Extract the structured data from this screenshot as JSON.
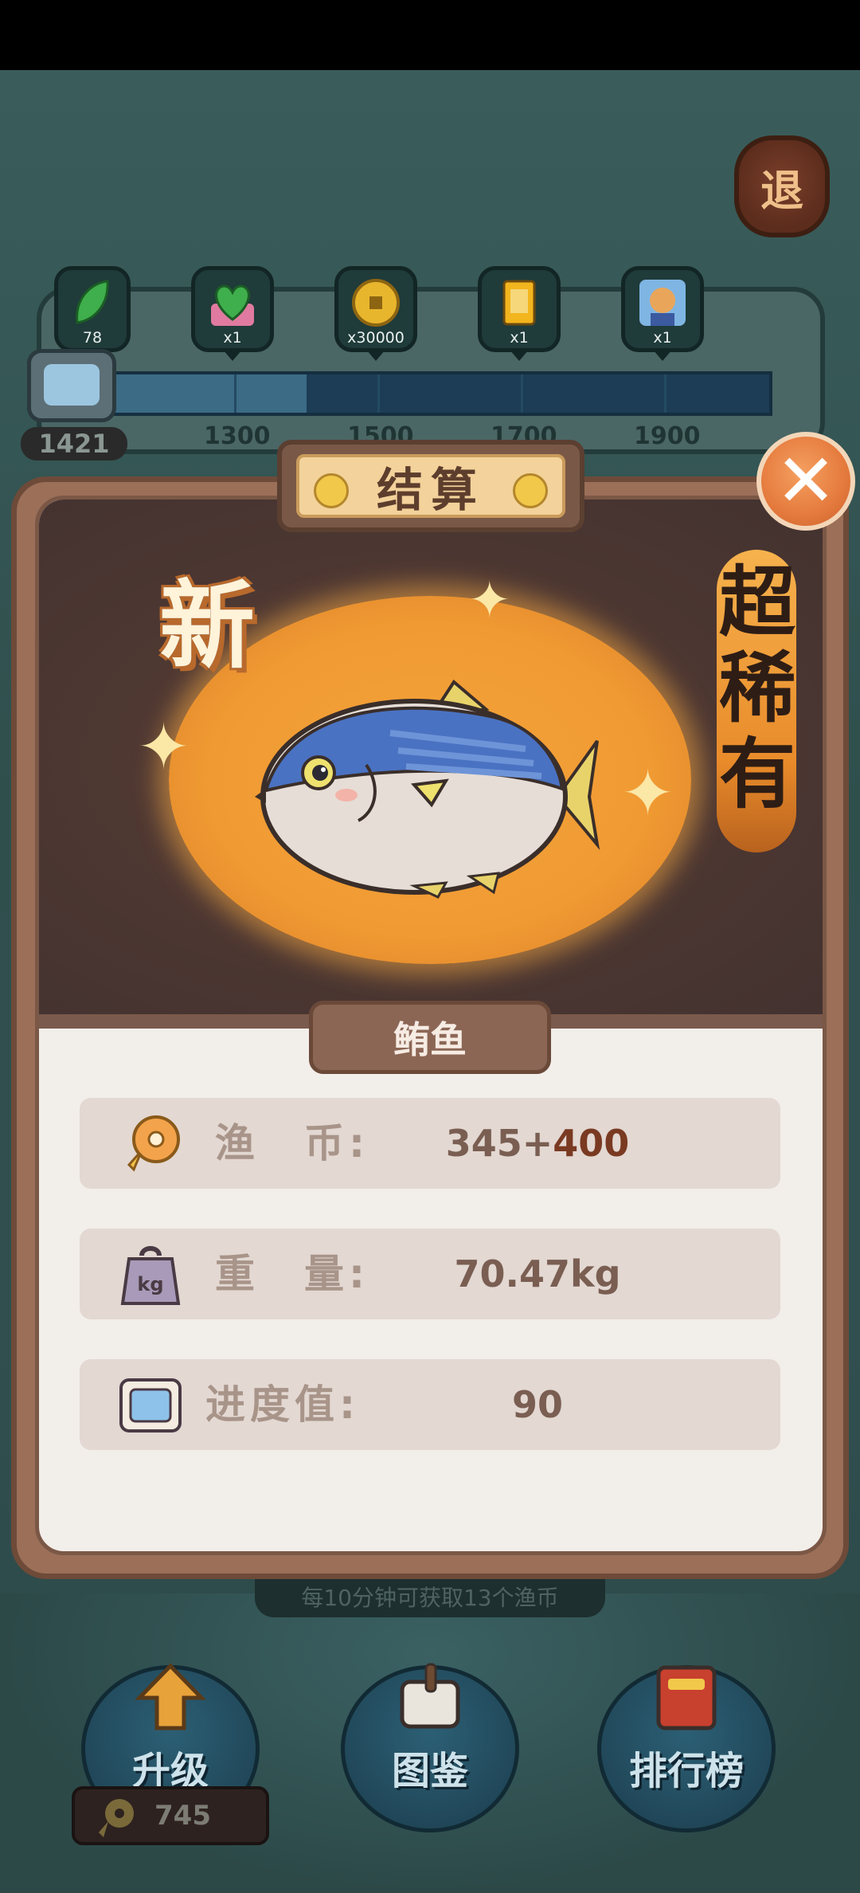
{
  "exit_button": {
    "label": "退"
  },
  "rewards": [
    {
      "icon": "green-leaf-icon",
      "count": "78"
    },
    {
      "icon": "heart-gift-icon",
      "count": "x1"
    },
    {
      "icon": "gold-coin-icon",
      "count": "x30000"
    },
    {
      "icon": "card-icon",
      "count": "x1"
    },
    {
      "icon": "character-icon",
      "count": "x1"
    }
  ],
  "progress": {
    "current": "1421",
    "milestones": [
      "1300",
      "1500",
      "1700",
      "1900"
    ],
    "fill_fraction": 0.31
  },
  "result_dialog": {
    "title": "结算",
    "new_label": "新",
    "rarity": "超稀有",
    "fish_name": "鲔鱼",
    "stats": [
      {
        "icon": "fish-coin-icon",
        "label": "渔　币:",
        "value_base": "345+",
        "value_bonus": "400"
      },
      {
        "icon": "weight-kg-icon",
        "label": "重　量:",
        "value_base": "70.47kg",
        "value_bonus": ""
      },
      {
        "icon": "progress-card-icon",
        "label": "进度值:",
        "value_base": "90",
        "value_bonus": ""
      }
    ]
  },
  "hint_text": "每10分钟可获取13个渔币",
  "bottom_nav": {
    "upgrade_label": "升级",
    "album_label": "图鉴",
    "leaderboard_label": "排行榜",
    "coins": "745"
  },
  "colors": {
    "accent_orange": "#e57a3d",
    "dialog_frame": "#9b6f58",
    "panel_bg": "#f2eeea"
  }
}
